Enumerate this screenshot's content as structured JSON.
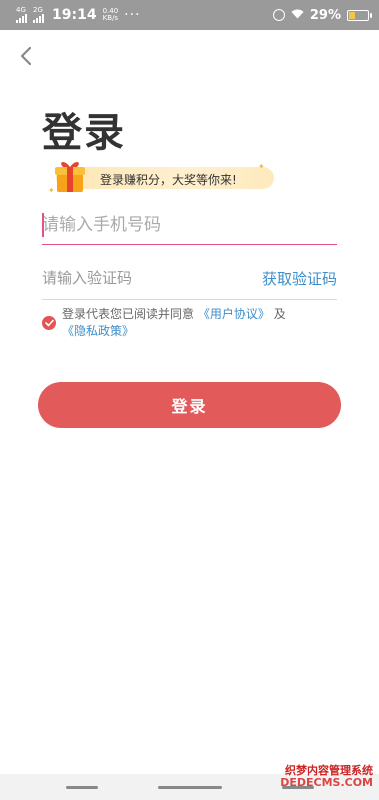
{
  "status_bar": {
    "network_1": "4G",
    "network_2": "2G",
    "time": "19:14",
    "speed_value": "0.40",
    "speed_unit": "KB/s",
    "more": "···",
    "battery_percent": "29%",
    "battery_level": 0.29,
    "battery_color": "#f3c64a"
  },
  "page": {
    "title": "登录",
    "promo_text": "登录赚积分，大奖等你来!",
    "phone_placeholder": "请输入手机号码",
    "code_placeholder": "请输入验证码",
    "get_code_label": "获取验证码",
    "agreement": {
      "prefix": "登录代表您已阅读并同意",
      "user_agreement": "《用户协议》",
      "and": "及",
      "privacy_policy": "《隐私政策》"
    },
    "login_button": "登录"
  },
  "watermark": {
    "line1": "织梦内容管理系统",
    "line2": "DEDECMS.COM"
  },
  "colors": {
    "accent_red": "#e25a5a",
    "link_blue": "#3d8ec9",
    "input_focus": "#e3508c",
    "promo_bg": "#fde6b3"
  }
}
